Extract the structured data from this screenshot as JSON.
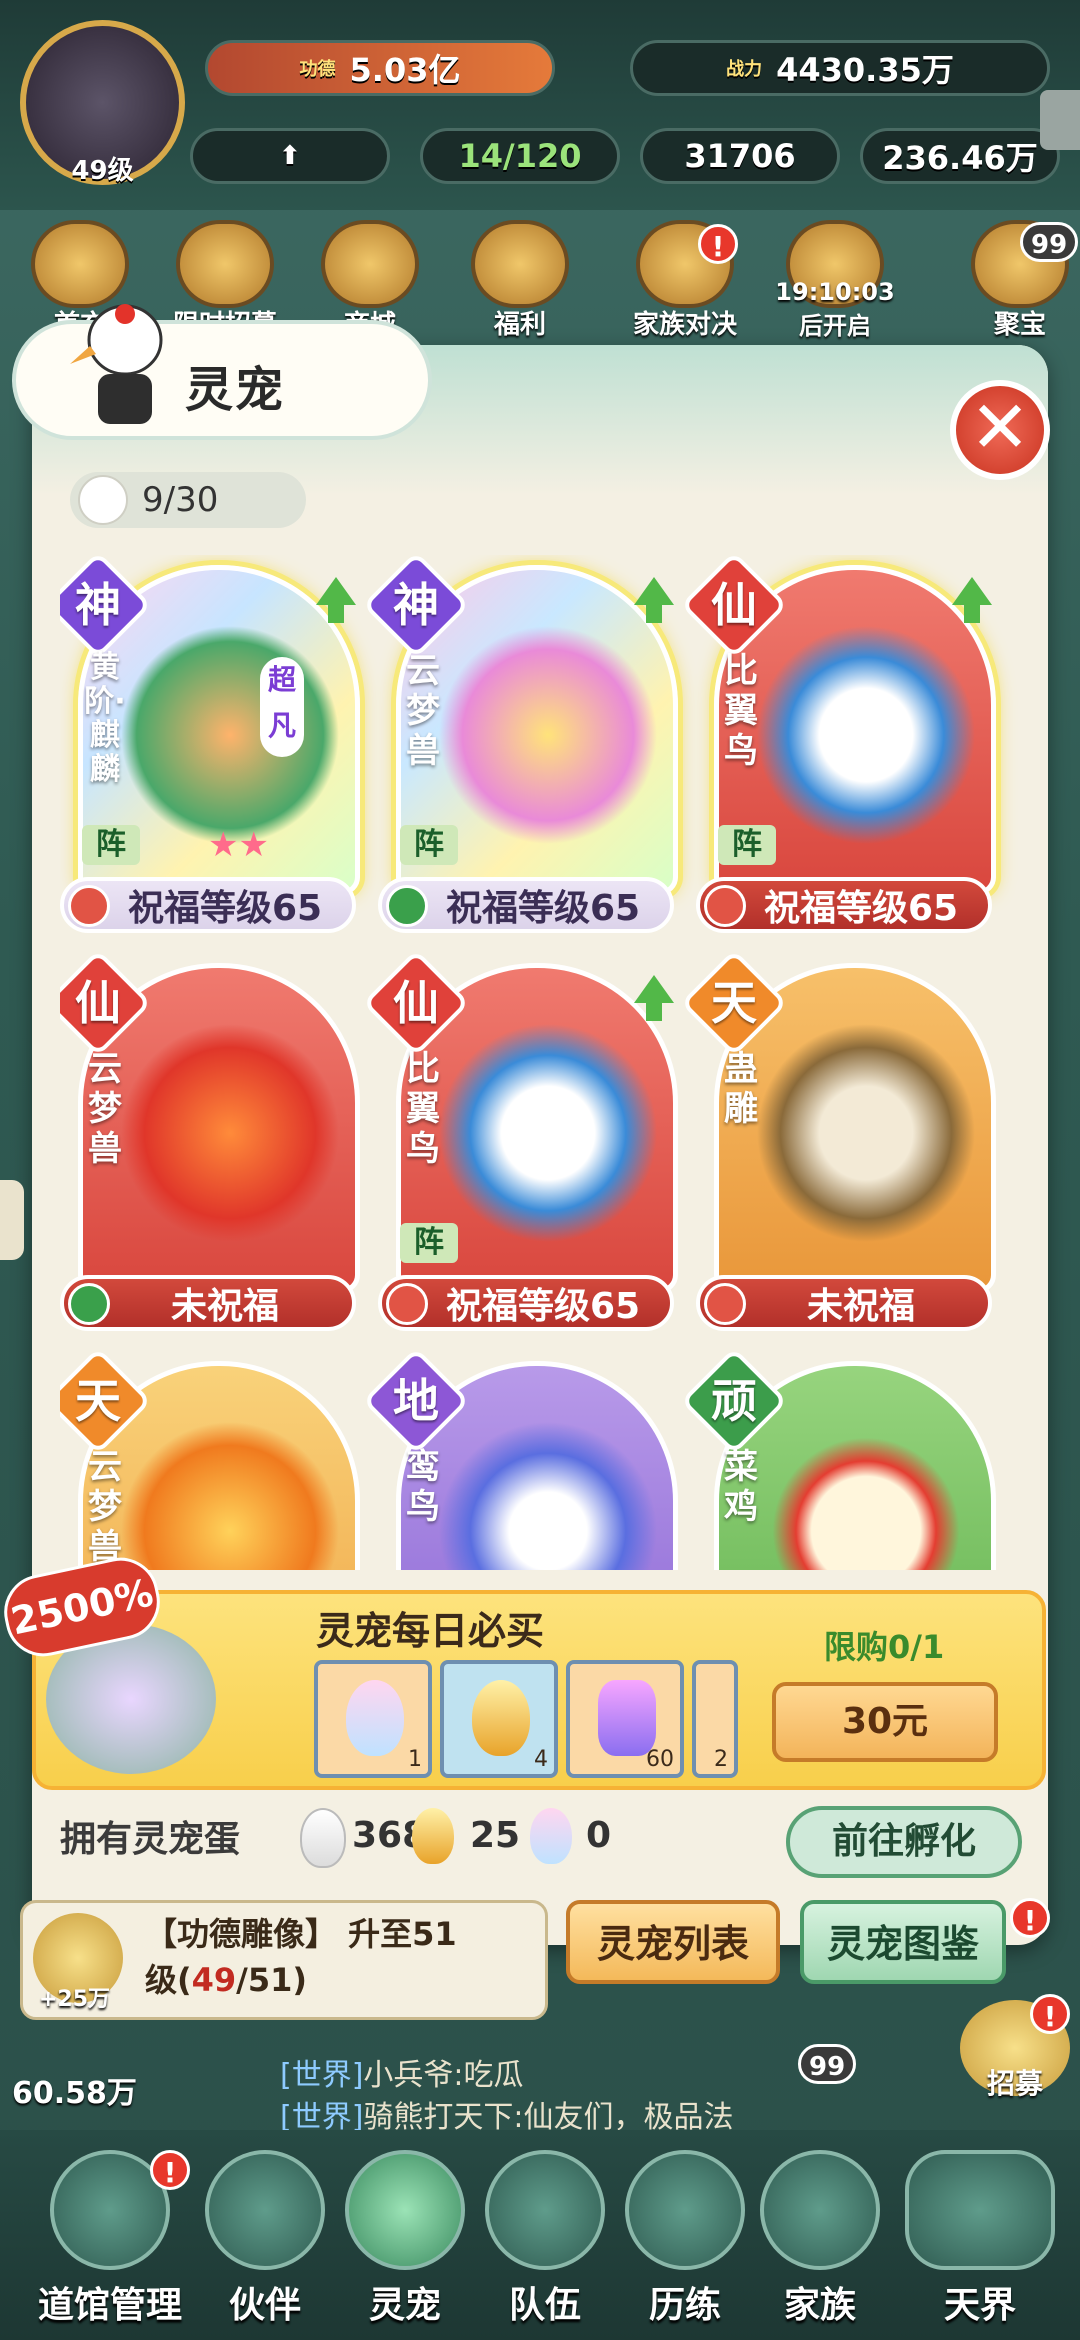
{
  "top": {
    "level": "49级",
    "merit_tag": "功德",
    "merit_value": "5.03亿",
    "power_tag": "战力",
    "power_value": "4430.35万",
    "progress": "14/120",
    "coin2": "31706",
    "coin3": "236.46万"
  },
  "icons": [
    {
      "label": "首充"
    },
    {
      "label": "限时招募"
    },
    {
      "label": "商城"
    },
    {
      "label": "福利"
    },
    {
      "label": "家族对决"
    },
    {
      "label": "19:10:03",
      "sub": "后开启"
    },
    {
      "label": "聚宝"
    }
  ],
  "badges": {
    "chat_count": "99",
    "alert": "!"
  },
  "modal": {
    "title": "灵宠",
    "close": "✕",
    "counter": "9/30"
  },
  "pets": [
    {
      "grade": "神",
      "name": "黄阶·麒麟",
      "badge": "超凡",
      "form": "阵",
      "bless": "祝福等级65",
      "stars": "★★",
      "grade_color": "#7b4bd8",
      "card_color": "rainbow"
    },
    {
      "grade": "神",
      "name": "云梦兽",
      "form": "阵",
      "bless": "祝福等级65",
      "grade_color": "#7b4bd8",
      "card_color": "rainbow"
    },
    {
      "grade": "仙",
      "name": "比翼鸟",
      "form": "阵",
      "bless": "祝福等级65",
      "grade_color": "#e0413a",
      "card_color": "#e05d58"
    },
    {
      "grade": "仙",
      "name": "云梦兽",
      "bless": "未祝福",
      "grade_color": "#e0413a",
      "card_color": "#e05d58"
    },
    {
      "grade": "仙",
      "name": "比翼鸟",
      "form": "阵",
      "bless": "祝福等级65",
      "grade_color": "#e0413a",
      "card_color": "#e05d58"
    },
    {
      "grade": "天",
      "name": "蛊雕",
      "bless": "未祝福",
      "grade_color": "#f08a2a",
      "card_color": "#f2a94a"
    },
    {
      "grade": "天",
      "name": "云梦兽",
      "grade_color": "#f08a2a",
      "card_color": "#f2b24f"
    },
    {
      "grade": "地",
      "name": "鸾鸟",
      "grade_color": "#8d57d6",
      "card_color": "#a88ae0"
    },
    {
      "grade": "顽",
      "name": "菜鸡",
      "grade_color": "#3c9d4b",
      "card_color": "#7cc466"
    }
  ],
  "shop": {
    "percent": "2500%",
    "title": "灵宠每日必买",
    "limit": "限购0/1",
    "price": "30元",
    "items": [
      {
        "qty": "1"
      },
      {
        "qty": "4"
      },
      {
        "qty": "60"
      },
      {
        "qty": "2"
      }
    ]
  },
  "owned": {
    "label": "拥有灵宠蛋",
    "v1": "368",
    "v2": "25",
    "v3": "0",
    "hatch": "前往孵化"
  },
  "tabs": {
    "list": "灵宠列表",
    "dex": "灵宠图鉴"
  },
  "quest": {
    "reward": "+25万",
    "text1": "【功德雕像】 升至51",
    "text2_prefix": "级(",
    "text2_red": "49",
    "text2_suffix": "/51)"
  },
  "side": {
    "recruit": "招募",
    "gold": "60.58万"
  },
  "chat": [
    {
      "channel": "[世界]",
      "text": "小兵爷:吃瓜"
    },
    {
      "channel": "[世界]",
      "text": "骑熊打天下:仙友们，极品法"
    }
  ],
  "nav": [
    {
      "label": "道馆管理"
    },
    {
      "label": "伙伴"
    },
    {
      "label": "灵宠"
    },
    {
      "label": "队伍"
    },
    {
      "label": "历练"
    },
    {
      "label": "家族"
    },
    {
      "label": "天界"
    }
  ]
}
